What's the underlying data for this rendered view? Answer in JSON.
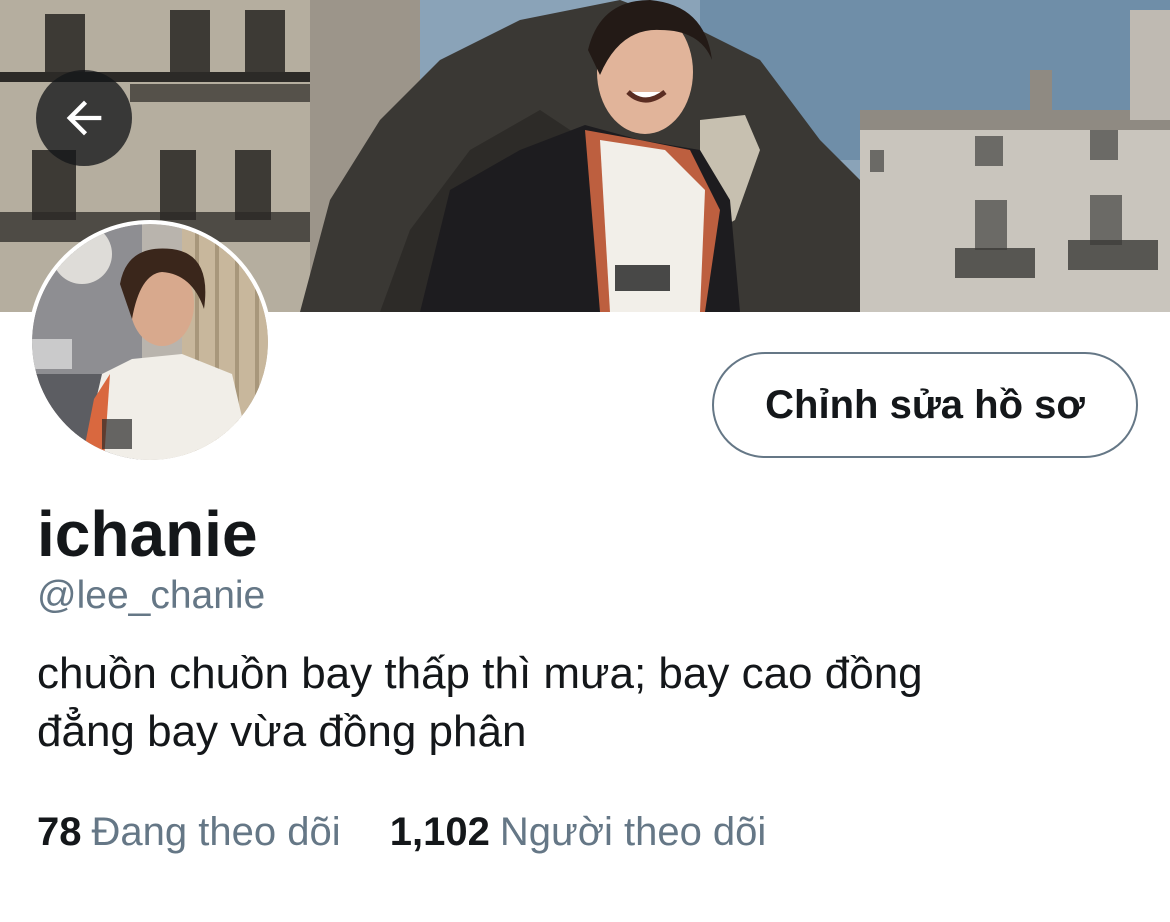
{
  "header": {
    "back_icon": "arrow-left-icon",
    "banner": "profile-banner-photo"
  },
  "profile": {
    "avatar": "profile-avatar-photo",
    "edit_button_label": "Chỉnh sửa hồ sơ",
    "display_name": "ichanie",
    "handle": "@lee_chanie",
    "bio_line_1": "chuồn chuồn bay thấp thì mưa; bay cao đồng",
    "bio_line_2": "đẳng bay vừa đồng phân"
  },
  "stats": {
    "following_count": "78",
    "following_label": "Đang theo dõi",
    "followers_count": "1,102",
    "followers_label": "Người theo dõi"
  },
  "colors": {
    "text_primary": "#14171a",
    "text_secondary": "#657786",
    "button_border": "#657786"
  }
}
